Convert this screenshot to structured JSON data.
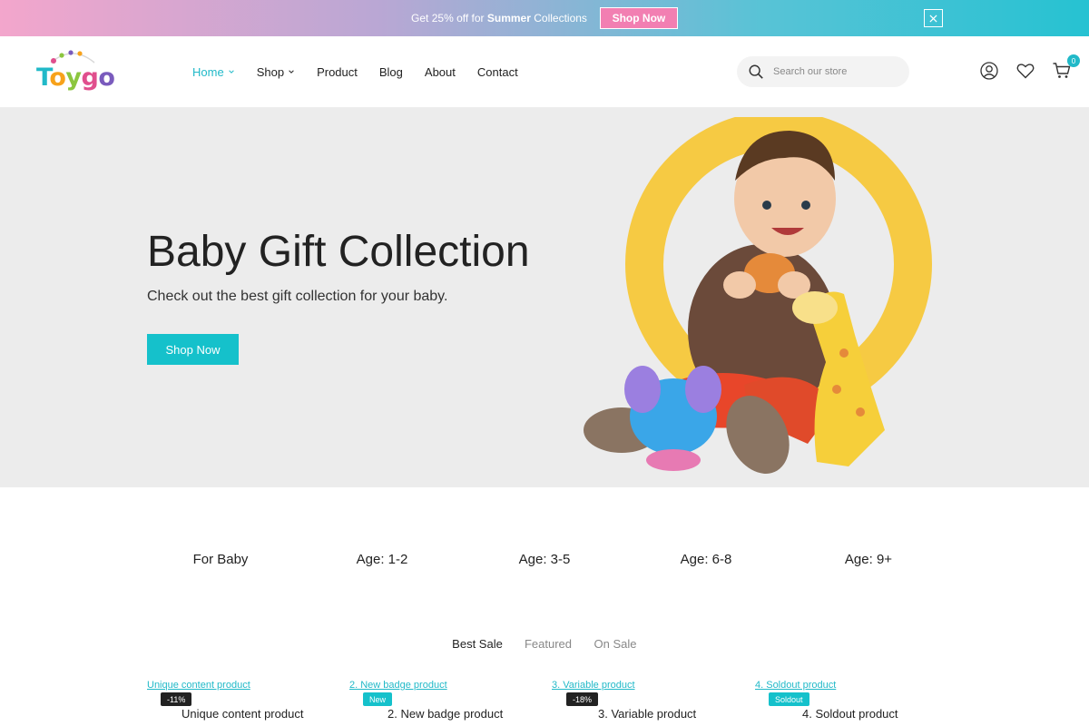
{
  "announcement": {
    "text_prefix": "Get 25% off for ",
    "text_bold": "Summer",
    "text_suffix": " Collections",
    "button_label": "Shop Now"
  },
  "header": {
    "logo_text": "Toygo",
    "nav": [
      {
        "label": "Home",
        "has_dropdown": true,
        "active": true
      },
      {
        "label": "Shop",
        "has_dropdown": true,
        "active": false
      },
      {
        "label": "Product",
        "has_dropdown": false,
        "active": false
      },
      {
        "label": "Blog",
        "has_dropdown": false,
        "active": false
      },
      {
        "label": "About",
        "has_dropdown": false,
        "active": false
      },
      {
        "label": "Contact",
        "has_dropdown": false,
        "active": false
      }
    ],
    "search_placeholder": "Search our store",
    "cart_count": "0",
    "icons": [
      "search-icon",
      "account-icon",
      "heart-icon",
      "cart-icon"
    ]
  },
  "hero": {
    "title": "Baby Gift Collection",
    "subtitle": "Check out the best gift collection for your baby.",
    "button_label": "Shop Now"
  },
  "categories": [
    "For Baby",
    "Age: 1-2",
    "Age: 3-5",
    "Age: 6-8",
    "Age: 9+"
  ],
  "product_tabs": [
    {
      "label": "Best Sale",
      "active": true
    },
    {
      "label": "Featured",
      "active": false
    },
    {
      "label": "On Sale",
      "active": false
    }
  ],
  "products": [
    {
      "link": "Unique content product",
      "badge": "-11%",
      "badge_style": "dark",
      "name": "Unique content product"
    },
    {
      "link": "2. New badge product",
      "badge": "New",
      "badge_style": "teal",
      "name": "2. New badge product"
    },
    {
      "link": "3. Variable product",
      "badge": "-18%",
      "badge_style": "dark",
      "name": "3. Variable product"
    },
    {
      "link": "4. Soldout product",
      "badge": "Soldout",
      "badge_style": "teal",
      "name": "4. Soldout product"
    }
  ],
  "colors": {
    "accent": "#21b9c8",
    "button": "#15c1cb",
    "promo_button": "#f27fb2",
    "hero_bg": "#ececec",
    "ring": "#f7c83a"
  }
}
